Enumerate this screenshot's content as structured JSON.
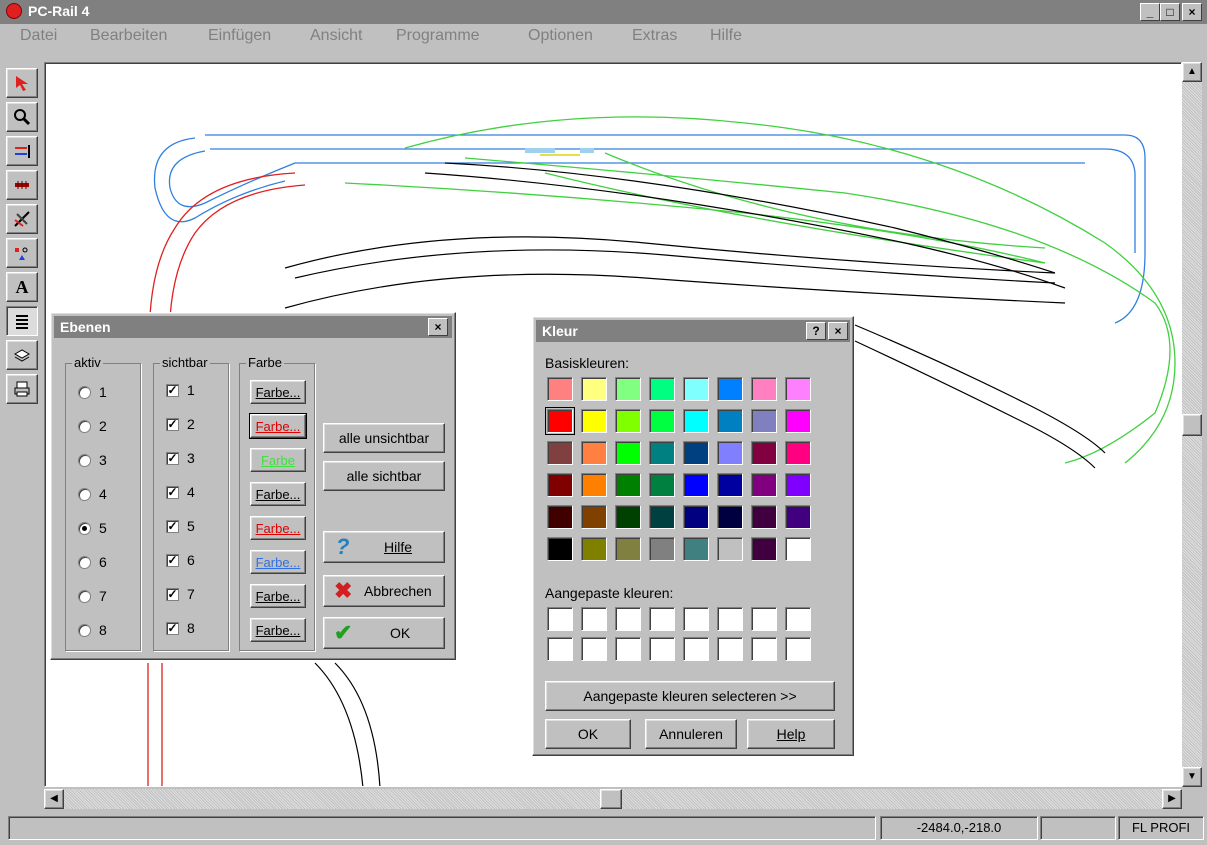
{
  "window": {
    "title": "PC-Rail 4",
    "logo_icon": "pcrail-logo-icon",
    "minimize": "_",
    "maximize": "□",
    "close": "×"
  },
  "menu": [
    {
      "label": "Datei"
    },
    {
      "label": "Bearbeiten"
    },
    {
      "label": "Einfügen"
    },
    {
      "label": "Ansicht"
    },
    {
      "label": "Programme"
    },
    {
      "label": "Optionen"
    },
    {
      "label": "Extras"
    },
    {
      "label": "Hilfe"
    }
  ],
  "toolbar": [
    {
      "icon": "pointer-arrow-icon"
    },
    {
      "icon": "zoom-icon"
    },
    {
      "icon": "track-connect-icon"
    },
    {
      "icon": "track-segment-icon"
    },
    {
      "icon": "turnout-icon"
    },
    {
      "icon": "signal-icon"
    },
    {
      "icon": "text-tool-icon",
      "glyph": "A"
    },
    {
      "icon": "layers-icon"
    },
    {
      "icon": "stack-icon"
    },
    {
      "icon": "print-icon"
    }
  ],
  "ebenen_dialog": {
    "title": "Ebenen",
    "close": "×",
    "aktiv_label": "aktiv",
    "sichtbar_label": "sichtbar",
    "farbe_label": "Farbe",
    "layers": [
      {
        "num": "1",
        "farbe": "Farbe...",
        "color": "#000000"
      },
      {
        "num": "2",
        "farbe": "Farbe...",
        "color": "#e00000"
      },
      {
        "num": "3",
        "farbe": "Farbe",
        "color": "#40e040"
      },
      {
        "num": "4",
        "farbe": "Farbe...",
        "color": "#000000"
      },
      {
        "num": "5",
        "farbe": "Farbe...",
        "color": "#e00000"
      },
      {
        "num": "6",
        "farbe": "Farbe...",
        "color": "#3070e0"
      },
      {
        "num": "7",
        "farbe": "Farbe...",
        "color": "#000000"
      },
      {
        "num": "8",
        "farbe": "Farbe...",
        "color": "#000000"
      }
    ],
    "active_layer": "5",
    "all_invisible": "alle unsichtbar",
    "all_visible": "alle sichtbar",
    "help": "Hilfe",
    "cancel": "Abbrechen",
    "ok": "OK"
  },
  "kleur_dialog": {
    "title": "Kleur",
    "help_btn": "?",
    "close": "×",
    "basic_label": "Basiskleuren:",
    "basic_colors": [
      [
        "#ff8080",
        "#ffff80",
        "#80ff80",
        "#00ff80",
        "#80ffff",
        "#0080ff",
        "#ff80c0",
        "#ff80ff"
      ],
      [
        "#ff0000",
        "#ffff00",
        "#80ff00",
        "#00ff40",
        "#00ffff",
        "#0080c0",
        "#8080c0",
        "#ff00ff"
      ],
      [
        "#804040",
        "#ff8040",
        "#00ff00",
        "#008080",
        "#004080",
        "#8080ff",
        "#800040",
        "#ff0080"
      ],
      [
        "#800000",
        "#ff8000",
        "#008000",
        "#008040",
        "#0000ff",
        "#0000a0",
        "#800080",
        "#8000ff"
      ],
      [
        "#400000",
        "#804000",
        "#004000",
        "#004040",
        "#000080",
        "#000040",
        "#400040",
        "#400080"
      ],
      [
        "#000000",
        "#808000",
        "#808040",
        "#808080",
        "#408080",
        "#c0c0c0",
        "#400040",
        "#ffffff"
      ]
    ],
    "custom_label": "Aangepaste kleuren:",
    "define_custom": "Aangepaste kleuren selecteren >>",
    "ok": "OK",
    "cancel": "Annuleren",
    "help": "Help"
  },
  "status": {
    "coords": "-2484.0,-218.0",
    "mode": "FL PROFI"
  },
  "scroll": {
    "up": "▲",
    "down": "▼",
    "left": "◀",
    "right": "▶"
  }
}
